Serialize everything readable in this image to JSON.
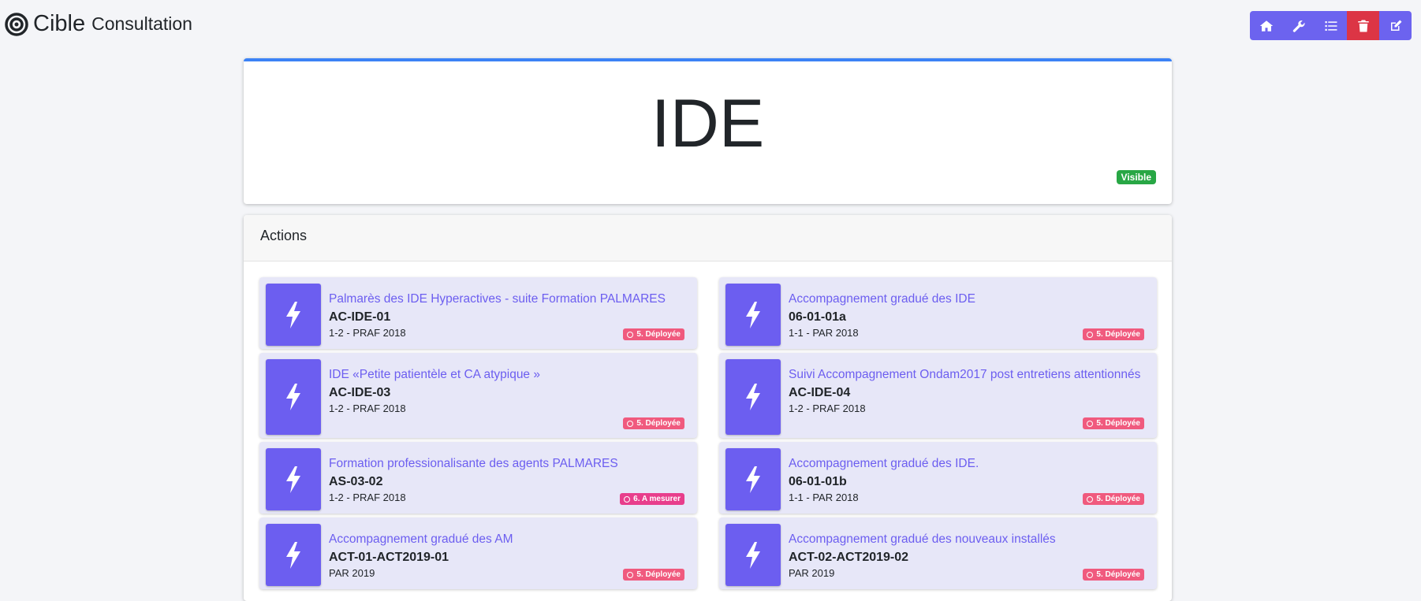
{
  "app": {
    "title": "Cible",
    "subtitle": "Consultation"
  },
  "toolbar": {
    "buttons": [
      {
        "name": "home-button",
        "icon": "home-icon"
      },
      {
        "name": "settings-button",
        "icon": "wrench-icon"
      },
      {
        "name": "list-button",
        "icon": "list-icon"
      },
      {
        "name": "delete-button",
        "icon": "trash-icon"
      },
      {
        "name": "edit-button",
        "icon": "edit-icon"
      }
    ]
  },
  "target": {
    "title": "IDE",
    "status": "Visible"
  },
  "actions": {
    "header": "Actions",
    "items": [
      {
        "title": "Palmarès des IDE Hyperactives - suite Formation PALMARES",
        "code": "AC-IDE-01",
        "sub": "1-2 - PRAF 2018",
        "status": "5. Déployée",
        "status_color": "#f05a7e"
      },
      {
        "title": "Accompagnement gradué des IDE",
        "code": "06-01-01a",
        "sub": "1-1 - PAR 2018",
        "status": "5. Déployée",
        "status_color": "#f05a7e"
      },
      {
        "title": "IDE «Petite patientèle et CA atypique »",
        "code": "AC-IDE-03",
        "sub": "1-2 - PRAF 2018",
        "status": "5. Déployée",
        "status_color": "#f05a7e"
      },
      {
        "title": "Suivi Accompagnement Ondam2017 post entretiens attentionnés",
        "code": "AC-IDE-04",
        "sub": "1-2 - PRAF 2018",
        "status": "5. Déployée",
        "status_color": "#f05a7e"
      },
      {
        "title": "Formation professionalisante des agents PALMARES",
        "code": "AS-03-02",
        "sub": "1-2 - PRAF 2018",
        "status": "6. A mesurer",
        "status_color": "#e83e8c"
      },
      {
        "title": "Accompagnement gradué des IDE.",
        "code": "06-01-01b",
        "sub": "1-1 - PAR 2018",
        "status": "5. Déployée",
        "status_color": "#f05a7e"
      },
      {
        "title": "Accompagnement gradué des AM",
        "code": "ACT-01-ACT2019-01",
        "sub": "PAR 2019",
        "status": "5. Déployée",
        "status_color": "#f05a7e"
      },
      {
        "title": "Accompagnement gradué des nouveaux installés",
        "code": "ACT-02-ACT2019-02",
        "sub": "PAR 2019",
        "status": "5. Déployée",
        "status_color": "#f05a7e"
      }
    ]
  }
}
